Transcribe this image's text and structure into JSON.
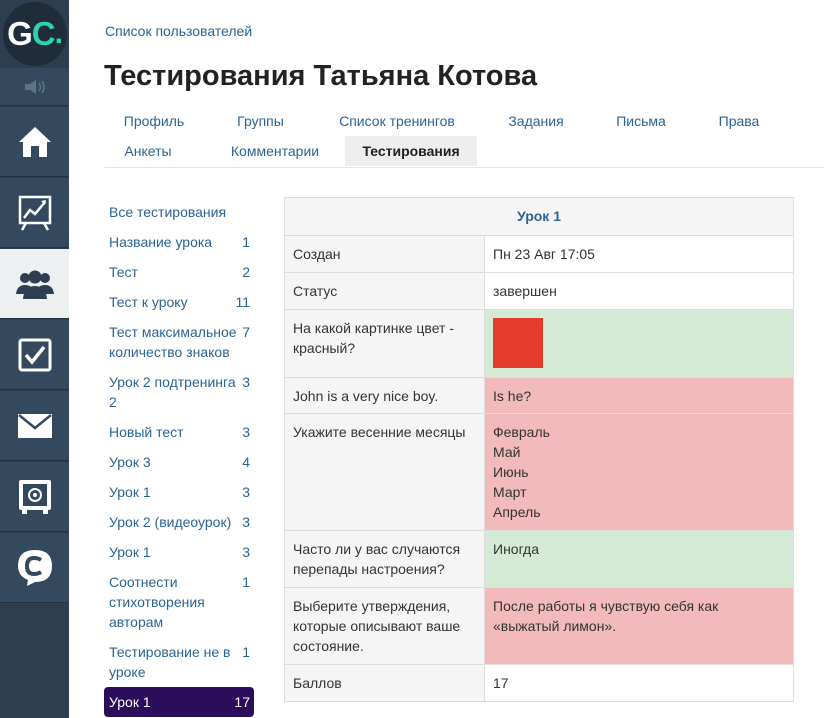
{
  "logo": {
    "letter_g": "G",
    "letter_c": "C",
    "dot": "."
  },
  "sidebar": {
    "icons": [
      "speaker-icon",
      "home-icon",
      "chart-icon",
      "users-icon",
      "checkbox-icon",
      "mail-icon",
      "safe-icon",
      "chat-icon"
    ]
  },
  "breadcrumb": "Список пользователей",
  "title": "Тестирования Татьяна Котова",
  "tabs": [
    {
      "label": "Профиль"
    },
    {
      "label": "Группы"
    },
    {
      "label": "Список тренингов"
    },
    {
      "label": "Задания"
    },
    {
      "label": "Письма"
    },
    {
      "label": "Права"
    },
    {
      "label": "Анкеты"
    },
    {
      "label": "Комментарии"
    },
    {
      "label": "Тестирования"
    }
  ],
  "active_tab": "Тестирования",
  "tests": [
    {
      "name": "Все тестирования",
      "count": ""
    },
    {
      "name": "Название урока",
      "count": "1"
    },
    {
      "name": "Тест",
      "count": "2"
    },
    {
      "name": "Тест к уроку",
      "count": "11"
    },
    {
      "name": "Тест максимальное количество знаков",
      "count": "7"
    },
    {
      "name": "Урок 2 подтренинга 2",
      "count": "3"
    },
    {
      "name": "Новый тест",
      "count": "3"
    },
    {
      "name": "Урок 3",
      "count": "4"
    },
    {
      "name": "Урок 1",
      "count": "3"
    },
    {
      "name": "Урок 2 (видеоурок)",
      "count": "3"
    },
    {
      "name": "Урок 1",
      "count": "3"
    },
    {
      "name": "Соотнести стихотворения авторам",
      "count": "1"
    },
    {
      "name": "Тестирование не в уроке",
      "count": "1"
    },
    {
      "name": "Урок 1",
      "count": "17"
    }
  ],
  "result": {
    "header": "Урок 1",
    "created_label": "Создан",
    "created_value": "Пн 23 Авг 17:05",
    "status_label": "Статус",
    "status_value": "завершен",
    "q1": "На какой картинке цвет - красный?",
    "q1_color": "#e63a2e",
    "q2": "John is a very nice boy.",
    "q2_answer": "Is he?",
    "q3": "Укажите весенние месяцы",
    "q3_answers": [
      "Февраль",
      "Май",
      "Июнь",
      "Март",
      "Апрель"
    ],
    "q4": "Часто ли у вас случаются перепады настроения?",
    "q4_answer": "Иногда",
    "q5": "Выберите утверждения, которые описывают ваше состояние.",
    "q5_answer": "После работы я чувствую себя как «выжатый лимон».",
    "score_label": "Баллов",
    "score_value": "17"
  },
  "colors": {
    "sidebar": "#2c3e50",
    "link": "#2a6496",
    "correct": "#d4ead4",
    "wrong": "#f2baba",
    "active_item": "#2b0d5c",
    "logo_accent": "#2bd3b0"
  }
}
